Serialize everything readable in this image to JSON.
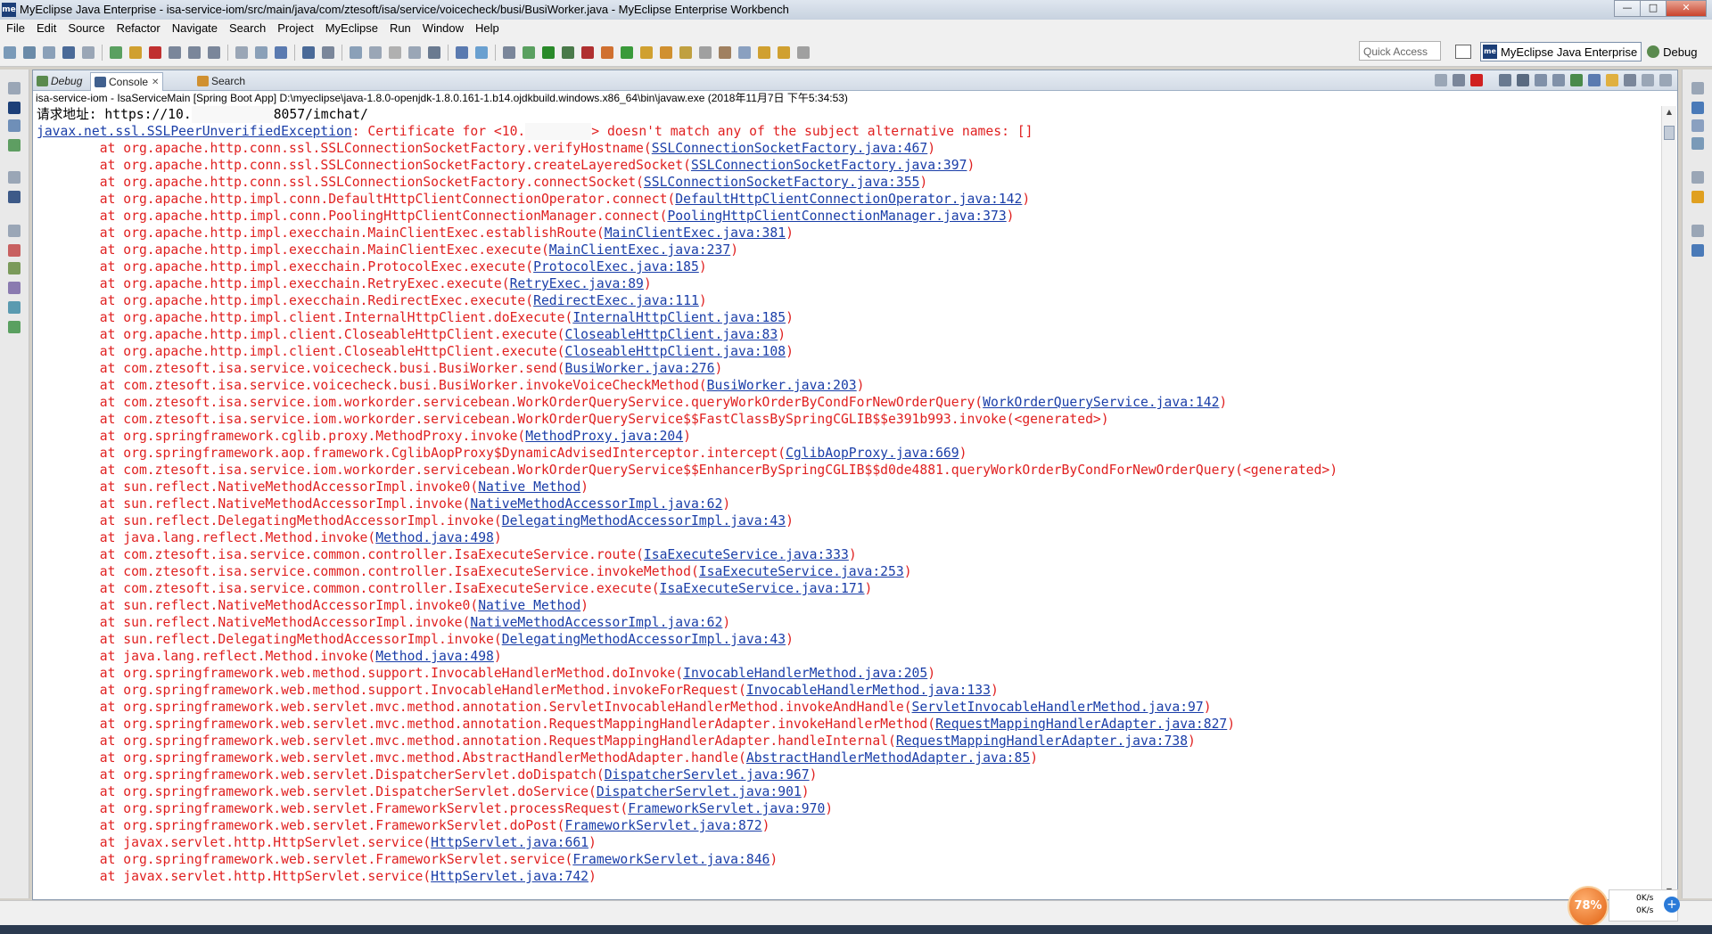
{
  "window": {
    "title": "MyEclipse Java Enterprise - isa-service-iom/src/main/java/com/ztesoft/isa/service/voicecheck/busi/BusiWorker.java - MyEclipse Enterprise Workbench",
    "logo": "me",
    "minimize": "—",
    "maximize": "□",
    "close": "✕"
  },
  "menu": [
    "File",
    "Edit",
    "Source",
    "Refactor",
    "Navigate",
    "Search",
    "Project",
    "MyEclipse",
    "Run",
    "Window",
    "Help"
  ],
  "toolbar": {
    "quick_access": "Quick Access",
    "perspective_active": "MyEclipse Java Enterprise",
    "perspective_debug": "Debug",
    "perspective_logo": "me"
  },
  "tabs": [
    {
      "label": "Debug"
    },
    {
      "label": "Console",
      "close": "✕"
    },
    {
      "label": "Search"
    }
  ],
  "console": {
    "header": "isa-service-iom - IsaServiceMain [Spring Boot App] D:\\myeclipse\\java-1.8.0-openjdk-1.8.0.161-1.b14.ojdkbuild.windows.x86_64\\bin\\javaw.exe (2018年11月7日 下午5:34:53)",
    "request_prefix": "请求地址: https://10.",
    "request_suffix": "8057/imchat/",
    "exception_class": "javax.net.ssl.SSLPeerUnverifiedException",
    "exception_msg_a": ": Certificate for <10.",
    "exception_msg_b": "> doesn't match any of the subject alternative names: []",
    "frames": [
      {
        "m": "org.apache.http.conn.ssl.SSLConnectionSocketFactory.verifyHostname",
        "l": "SSLConnectionSocketFactory.java:467"
      },
      {
        "m": "org.apache.http.conn.ssl.SSLConnectionSocketFactory.createLayeredSocket",
        "l": "SSLConnectionSocketFactory.java:397"
      },
      {
        "m": "org.apache.http.conn.ssl.SSLConnectionSocketFactory.connectSocket",
        "l": "SSLConnectionSocketFactory.java:355"
      },
      {
        "m": "org.apache.http.impl.conn.DefaultHttpClientConnectionOperator.connect",
        "l": "DefaultHttpClientConnectionOperator.java:142"
      },
      {
        "m": "org.apache.http.impl.conn.PoolingHttpClientConnectionManager.connect",
        "l": "PoolingHttpClientConnectionManager.java:373"
      },
      {
        "m": "org.apache.http.impl.execchain.MainClientExec.establishRoute",
        "l": "MainClientExec.java:381"
      },
      {
        "m": "org.apache.http.impl.execchain.MainClientExec.execute",
        "l": "MainClientExec.java:237"
      },
      {
        "m": "org.apache.http.impl.execchain.ProtocolExec.execute",
        "l": "ProtocolExec.java:185"
      },
      {
        "m": "org.apache.http.impl.execchain.RetryExec.execute",
        "l": "RetryExec.java:89"
      },
      {
        "m": "org.apache.http.impl.execchain.RedirectExec.execute",
        "l": "RedirectExec.java:111"
      },
      {
        "m": "org.apache.http.impl.client.InternalHttpClient.doExecute",
        "l": "InternalHttpClient.java:185"
      },
      {
        "m": "org.apache.http.impl.client.CloseableHttpClient.execute",
        "l": "CloseableHttpClient.java:83"
      },
      {
        "m": "org.apache.http.impl.client.CloseableHttpClient.execute",
        "l": "CloseableHttpClient.java:108"
      },
      {
        "m": "com.ztesoft.isa.service.voicecheck.busi.BusiWorker.send",
        "l": "BusiWorker.java:276"
      },
      {
        "m": "com.ztesoft.isa.service.voicecheck.busi.BusiWorker.invokeVoiceCheckMethod",
        "l": "BusiWorker.java:203"
      },
      {
        "m": "com.ztesoft.isa.service.iom.workorder.servicebean.WorkOrderQueryService.queryWorkOrderByCondForNewOrderQuery",
        "l": "WorkOrderQueryService.java:142"
      },
      {
        "m": "com.ztesoft.isa.service.iom.workorder.servicebean.WorkOrderQueryService$$FastClassBySpringCGLIB$$e391b993.invoke",
        "g": "<generated>"
      },
      {
        "m": "org.springframework.cglib.proxy.MethodProxy.invoke",
        "l": "MethodProxy.java:204"
      },
      {
        "m": "org.springframework.aop.framework.CglibAopProxy$DynamicAdvisedInterceptor.intercept",
        "l": "CglibAopProxy.java:669"
      },
      {
        "m": "com.ztesoft.isa.service.iom.workorder.servicebean.WorkOrderQueryService$$EnhancerBySpringCGLIB$$d0de4881.queryWorkOrderByCondForNewOrderQuery",
        "g": "<generated>"
      },
      {
        "m": "sun.reflect.NativeMethodAccessorImpl.invoke0",
        "l": "Native Method"
      },
      {
        "m": "sun.reflect.NativeMethodAccessorImpl.invoke",
        "l": "NativeMethodAccessorImpl.java:62"
      },
      {
        "m": "sun.reflect.DelegatingMethodAccessorImpl.invoke",
        "l": "DelegatingMethodAccessorImpl.java:43"
      },
      {
        "m": "java.lang.reflect.Method.invoke",
        "l": "Method.java:498"
      },
      {
        "m": "com.ztesoft.isa.service.common.controller.IsaExecuteService.route",
        "l": "IsaExecuteService.java:333"
      },
      {
        "m": "com.ztesoft.isa.service.common.controller.IsaExecuteService.invokeMethod",
        "l": "IsaExecuteService.java:253"
      },
      {
        "m": "com.ztesoft.isa.service.common.controller.IsaExecuteService.execute",
        "l": "IsaExecuteService.java:171"
      },
      {
        "m": "sun.reflect.NativeMethodAccessorImpl.invoke0",
        "l": "Native Method"
      },
      {
        "m": "sun.reflect.NativeMethodAccessorImpl.invoke",
        "l": "NativeMethodAccessorImpl.java:62"
      },
      {
        "m": "sun.reflect.DelegatingMethodAccessorImpl.invoke",
        "l": "DelegatingMethodAccessorImpl.java:43"
      },
      {
        "m": "java.lang.reflect.Method.invoke",
        "l": "Method.java:498"
      },
      {
        "m": "org.springframework.web.method.support.InvocableHandlerMethod.doInvoke",
        "l": "InvocableHandlerMethod.java:205"
      },
      {
        "m": "org.springframework.web.method.support.InvocableHandlerMethod.invokeForRequest",
        "l": "InvocableHandlerMethod.java:133"
      },
      {
        "m": "org.springframework.web.servlet.mvc.method.annotation.ServletInvocableHandlerMethod.invokeAndHandle",
        "l": "ServletInvocableHandlerMethod.java:97"
      },
      {
        "m": "org.springframework.web.servlet.mvc.method.annotation.RequestMappingHandlerAdapter.invokeHandlerMethod",
        "l": "RequestMappingHandlerAdapter.java:827"
      },
      {
        "m": "org.springframework.web.servlet.mvc.method.annotation.RequestMappingHandlerAdapter.handleInternal",
        "l": "RequestMappingHandlerAdapter.java:738"
      },
      {
        "m": "org.springframework.web.servlet.mvc.method.AbstractHandlerMethodAdapter.handle",
        "l": "AbstractHandlerMethodAdapter.java:85"
      },
      {
        "m": "org.springframework.web.servlet.DispatcherServlet.doDispatch",
        "l": "DispatcherServlet.java:967"
      },
      {
        "m": "org.springframework.web.servlet.DispatcherServlet.doService",
        "l": "DispatcherServlet.java:901"
      },
      {
        "m": "org.springframework.web.servlet.FrameworkServlet.processRequest",
        "l": "FrameworkServlet.java:970"
      },
      {
        "m": "org.springframework.web.servlet.FrameworkServlet.doPost",
        "l": "FrameworkServlet.java:872"
      },
      {
        "m": "javax.servlet.http.HttpServlet.service",
        "l": "HttpServlet.java:661"
      },
      {
        "m": "org.springframework.web.servlet.FrameworkServlet.service",
        "l": "FrameworkServlet.java:846"
      },
      {
        "m": "javax.servlet.http.HttpServlet.service",
        "l": "HttpServlet.java:742"
      }
    ]
  },
  "tray": {
    "cpu": "78%",
    "net_up": "0K/s",
    "net_down": "0K/s",
    "plus": "+"
  },
  "colors": {
    "error_text": "#e02020",
    "link_text": "#1a3ea8",
    "brand": "#1c3f78"
  }
}
